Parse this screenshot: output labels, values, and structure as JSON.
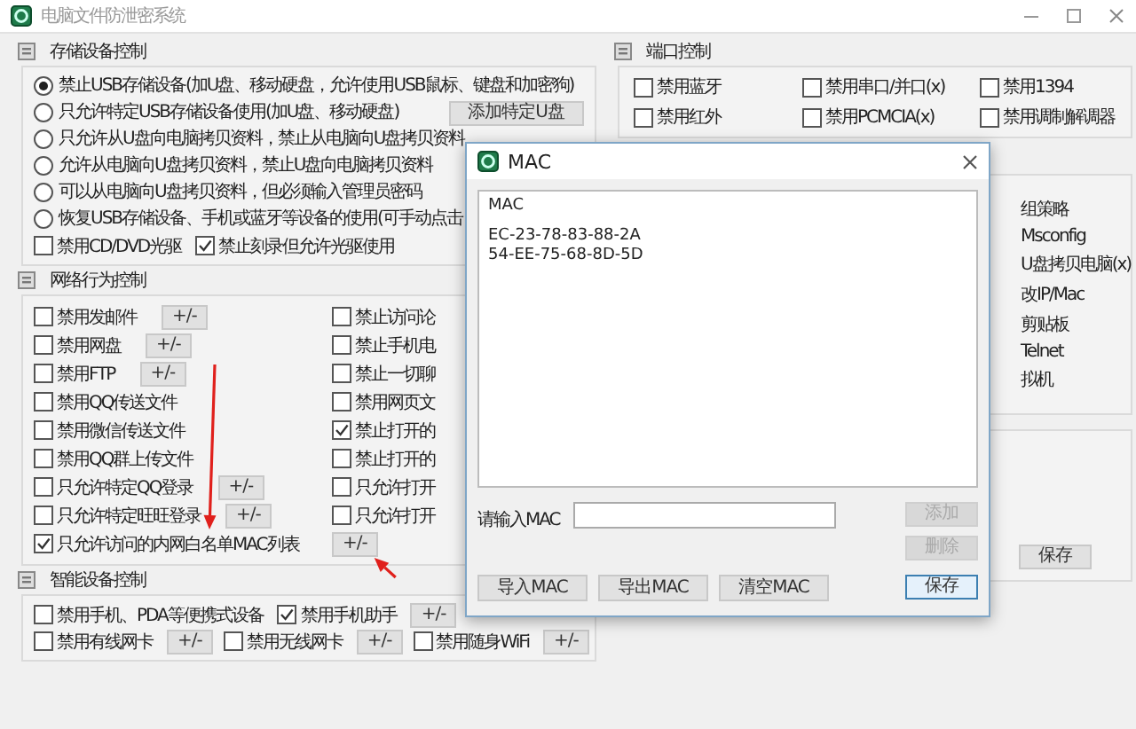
{
  "window": {
    "title": "电脑文件防泄密系统"
  },
  "storage": {
    "title": "存储设备控制",
    "options": [
      {
        "label": "禁止USB存储设备(加U盘、移动硬盘，允许使用USB鼠标、键盘和加密狗)",
        "selected": true
      },
      {
        "label": "只允许特定USB存储设备使用(加U盘、移动硬盘)",
        "selected": false,
        "button": "添加特定U盘"
      },
      {
        "label": "只允许从U盘向电脑拷贝资料，禁止从电脑向U盘拷贝资料",
        "selected": false
      },
      {
        "label": "允许从电脑向U盘拷贝资料，禁止U盘向电脑拷贝资料",
        "selected": false
      },
      {
        "label": "可以从电脑向U盘拷贝资料，但必须输入管理员密码",
        "selected": false
      },
      {
        "label": "恢复USB存储设备、手机或蓝牙等设备的使用(可手动点击",
        "selected": false
      }
    ],
    "checks": [
      {
        "label": "禁用CD/DVD光驱",
        "checked": false
      },
      {
        "label": "禁止刻录但允许光驱使用",
        "checked": true
      }
    ]
  },
  "network": {
    "title": "网络行为控制",
    "rows": [
      {
        "left": {
          "label": "禁用发邮件",
          "checked": false,
          "button": "+/-"
        },
        "right": {
          "kind": "check",
          "label": "禁止访问论",
          "checked": false
        }
      },
      {
        "left": {
          "label": "禁用网盘",
          "checked": false,
          "button": "+/-"
        },
        "right": {
          "kind": "check",
          "label": "禁止手机电",
          "checked": false
        }
      },
      {
        "left": {
          "label": "禁用FTP",
          "checked": false,
          "button": "+/-"
        },
        "right": {
          "kind": "check",
          "label": "禁止一切聊",
          "checked": false
        }
      },
      {
        "left": {
          "label": "禁用QQ传送文件",
          "checked": false
        },
        "right": {
          "kind": "check",
          "label": "禁用网页文",
          "checked": false
        }
      },
      {
        "left": {
          "label": "禁用微信传送文件",
          "checked": false
        },
        "right": {
          "kind": "check",
          "label": "禁止打开的",
          "checked": true
        }
      },
      {
        "left": {
          "label": "禁用QQ群上传文件",
          "checked": false
        },
        "right": {
          "kind": "check",
          "label": "禁止打开的",
          "checked": false
        }
      },
      {
        "left": {
          "label": "只允许特定QQ登录",
          "checked": false,
          "button": "+/-"
        },
        "right": {
          "kind": "check",
          "label": "只允许打开",
          "checked": false
        }
      },
      {
        "left": {
          "label": "只允许特定旺旺登录",
          "checked": false,
          "button": "+/-"
        },
        "right": {
          "kind": "check",
          "label": "只允许打开",
          "checked": false
        }
      },
      {
        "left": {
          "label": "只允许访问的内网白名单MAC列表",
          "checked": true
        },
        "right": {
          "kind": "button",
          "label": "+/-"
        }
      }
    ]
  },
  "smart": {
    "title": "智能设备控制",
    "rows": [
      [
        {
          "label": "禁用手机、PDA等便携式设备",
          "checked": false
        },
        {
          "label": "禁用手机助手",
          "checked": true,
          "button": "+/-"
        }
      ],
      [
        {
          "label": "禁用有线网卡",
          "checked": false,
          "button": "+/-"
        },
        {
          "label": "禁用无线网卡",
          "checked": false,
          "button": "+/-"
        },
        {
          "label": "禁用随身WiFi",
          "checked": false,
          "button": "+/-"
        }
      ]
    ]
  },
  "ports": {
    "title": "端口控制",
    "items": [
      {
        "label": "禁用蓝牙",
        "checked": false
      },
      {
        "label": "禁用串口/并口(x)",
        "checked": false
      },
      {
        "label": "禁用1394",
        "checked": false
      },
      {
        "label": "禁用红外",
        "checked": false
      },
      {
        "label": "禁用PCMCIA(x)",
        "checked": false
      },
      {
        "label": "禁用调制解调器",
        "checked": false
      }
    ]
  },
  "options_column": [
    "组策略",
    "Msconfig",
    "U盘拷贝电脑(x)",
    "改IP/Mac",
    "剪贴板",
    "Telnet",
    "拟机"
  ],
  "save_button": "保存",
  "dialog": {
    "title": "MAC",
    "list": {
      "header": "MAC",
      "rows": [
        "EC-23-78-83-88-2A",
        "54-EE-75-68-8D-5D"
      ]
    },
    "input": {
      "label": "请输入MAC"
    },
    "side_buttons": [
      {
        "label": "添加",
        "disabled": true
      },
      {
        "label": "删除",
        "disabled": true
      }
    ],
    "bottom_buttons": [
      {
        "label": "导入MAC"
      },
      {
        "label": "导出MAC"
      },
      {
        "label": "清空MAC"
      }
    ],
    "save": {
      "label": "保存",
      "default": true
    }
  },
  "annotations": [
    {
      "kind": "arrow"
    },
    {
      "kind": "arrow"
    }
  ]
}
